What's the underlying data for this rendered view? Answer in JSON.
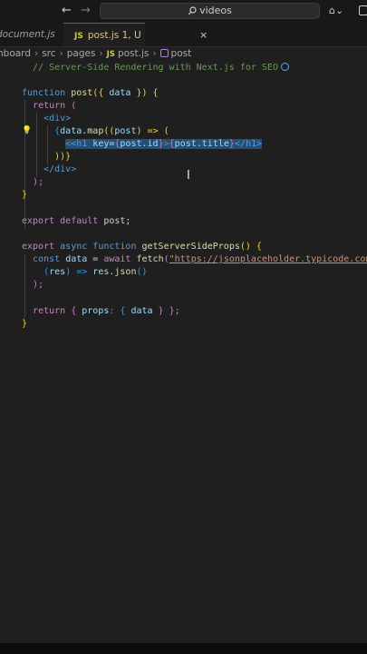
{
  "search": {
    "label": "videos"
  },
  "tabs": [
    {
      "label": "document.js"
    },
    {
      "icon_text": "JS",
      "label": "post.js 1, U",
      "close": "×"
    }
  ],
  "breadcrumb": [
    "nboard",
    "src",
    "pages",
    "post.js",
    "post"
  ],
  "breadcrumb_js": "JS",
  "code": {
    "l1": "// Server-Side Rendering with Next.js for SEO",
    "kw_function": "function",
    "fn_post": "post",
    "p_open": "({ ",
    "var_data": "data",
    "p_close": " }) {",
    "ctl_return": "return",
    "paren_open": " (",
    "div_open": "<div>",
    "map_open": "{",
    "map_data": "data",
    "map_dot": ".",
    "map_fn": "map",
    "map_args_open": "((",
    "map_post": "post",
    "map_arrow": ") => (",
    "h1_open": "<h1 ",
    "h1_key": "key",
    "h1_eq": "=",
    "h1_b1": "{",
    "h1_postid": "post.id",
    "h1_b2": "}",
    "h1_gt": ">",
    "h1_b3": "{",
    "h1_title": "post.title",
    "h1_b4": "}",
    "h1_close": "</h1>",
    "map_close": "))}",
    "div_close": "</div>",
    "paren_close": ");",
    "brace_close": "}",
    "kw_export": "export",
    "kw_default": "default",
    "export_post": "post;",
    "kw_async": "async",
    "fn_gssp": "getServerSideProps",
    "gssp_tail": "() {",
    "kw_const": "const",
    "var_data2": "data",
    "eq": " = ",
    "ctl_await": "await",
    "fn_fetch": "fetch",
    "fetch_open": "(",
    "str_url": "\"https://jsonplaceholder.typicode.com/t",
    "then_open": "(",
    "var_res": "res",
    "then_arrow": ") => ",
    "res_var": "res",
    "json_fn": ".json",
    "json_call": "()",
    "then_close": ");",
    "ret_open": " { ",
    "props_key": "props",
    "props_mid": ": { ",
    "props_data": "data",
    "props_end": " } };",
    "final_brace": "}"
  }
}
